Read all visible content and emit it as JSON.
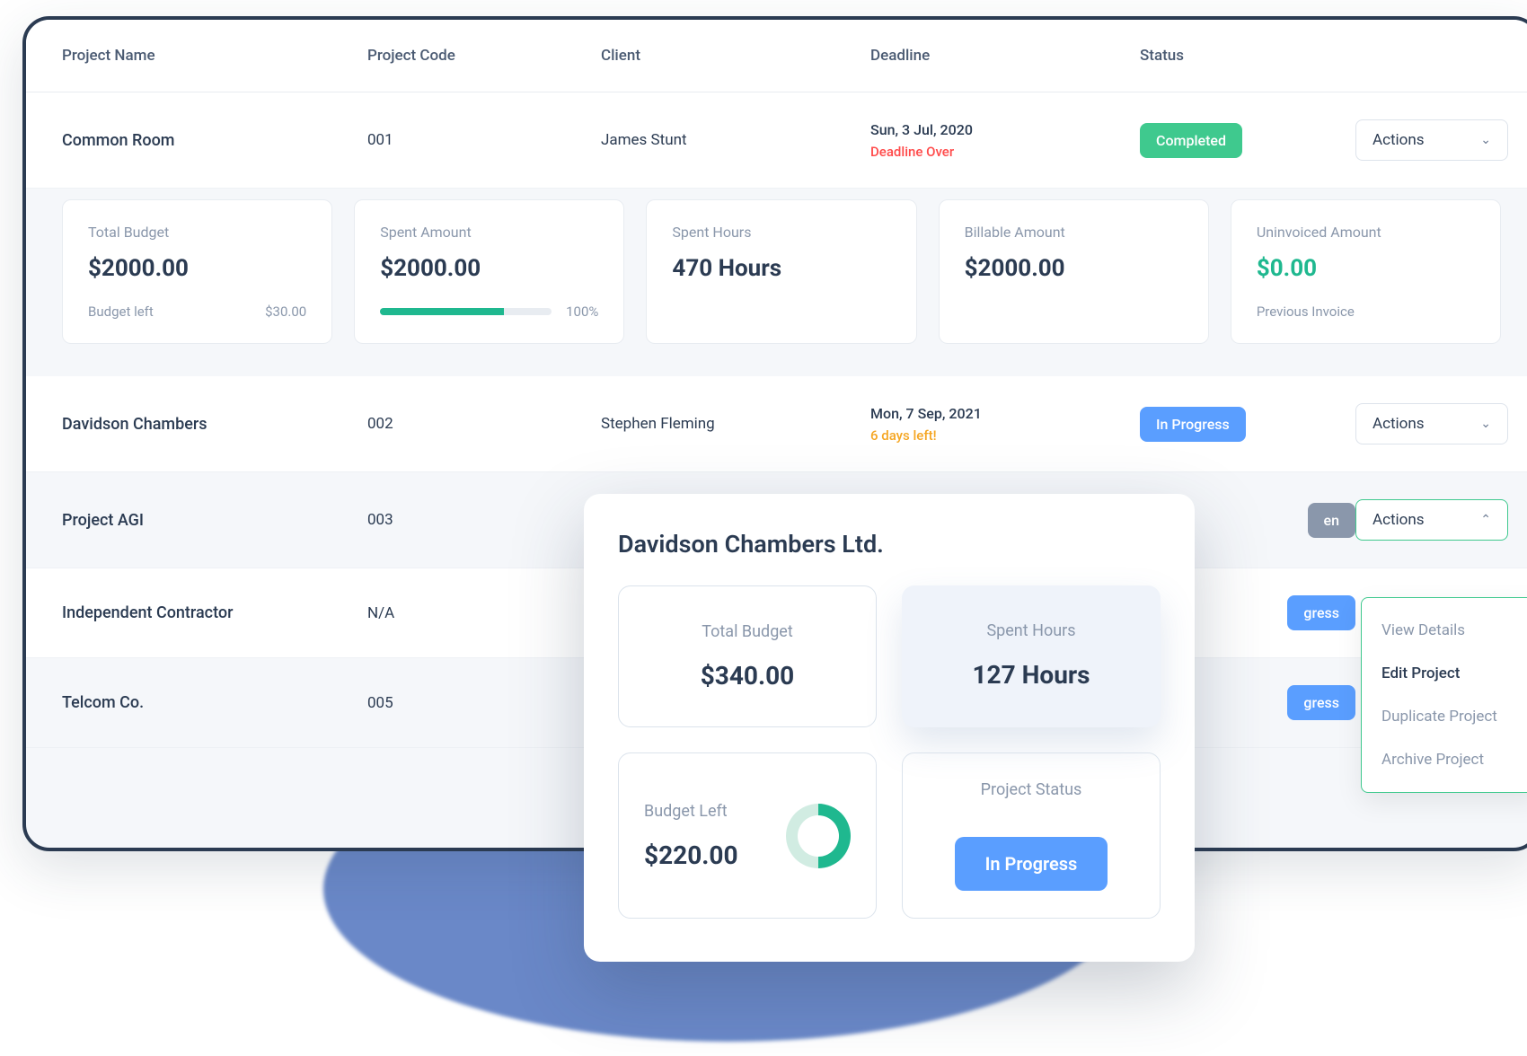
{
  "columns": {
    "name": "Project Name",
    "code": "Project Code",
    "client": "Client",
    "deadline": "Deadline",
    "status": "Status"
  },
  "actions_label": "Actions",
  "rows": [
    {
      "name": "Common Room",
      "code": "001",
      "client": "James Stunt",
      "deadline": "Sun, 3 Jul, 2020",
      "deadline_note": "Deadline Over",
      "deadline_note_class": "deadline-over",
      "status": "Completed",
      "status_class": "badge-completed"
    },
    {
      "name": "Davidson Chambers",
      "code": "002",
      "client": "Stephen Fleming",
      "deadline": "Mon, 7 Sep, 2021",
      "deadline_note": "6 days left!",
      "deadline_note_class": "deadline-left",
      "status": "In Progress",
      "status_class": "badge-progress"
    },
    {
      "name": "Project AGI",
      "code": "003",
      "client": "",
      "deadline": "",
      "deadline_note": "",
      "status": "en",
      "status_class": "badge-muted"
    },
    {
      "name": "Independent Contractor",
      "code": "N/A",
      "client": "",
      "deadline": "",
      "deadline_note": "",
      "status": "gress",
      "status_class": "badge-progress"
    },
    {
      "name": "Telcom Co.",
      "code": "005",
      "client": "",
      "deadline": "",
      "deadline_note": "",
      "status": "gress",
      "status_class": "badge-progress"
    }
  ],
  "expanded": {
    "total_budget_label": "Total Budget",
    "total_budget": "$2000.00",
    "budget_left_label": "Budget left",
    "budget_left": "$30.00",
    "spent_amount_label": "Spent Amount",
    "spent_amount": "$2000.00",
    "spent_pct": "100%",
    "spent_hours_label": "Spent Hours",
    "spent_hours": "470 Hours",
    "billable_label": "Billable Amount",
    "billable": "$2000.00",
    "uninvoiced_label": "Uninvoiced Amount",
    "uninvoiced": "$0.00",
    "prev_invoice_label": "Previous Invoice"
  },
  "popup": {
    "title": "Davidson Chambers Ltd.",
    "total_budget_label": "Total Budget",
    "total_budget": "$340.00",
    "spent_hours_label": "Spent Hours",
    "spent_hours": "127 Hours",
    "budget_left_label": "Budget Left",
    "budget_left": "$220.00",
    "status_label": "Project Status",
    "status_value": "In Progress"
  },
  "dropdown": {
    "view": "View Details",
    "edit": "Edit Project",
    "duplicate": "Duplicate Project",
    "archive": "Archive Project"
  }
}
